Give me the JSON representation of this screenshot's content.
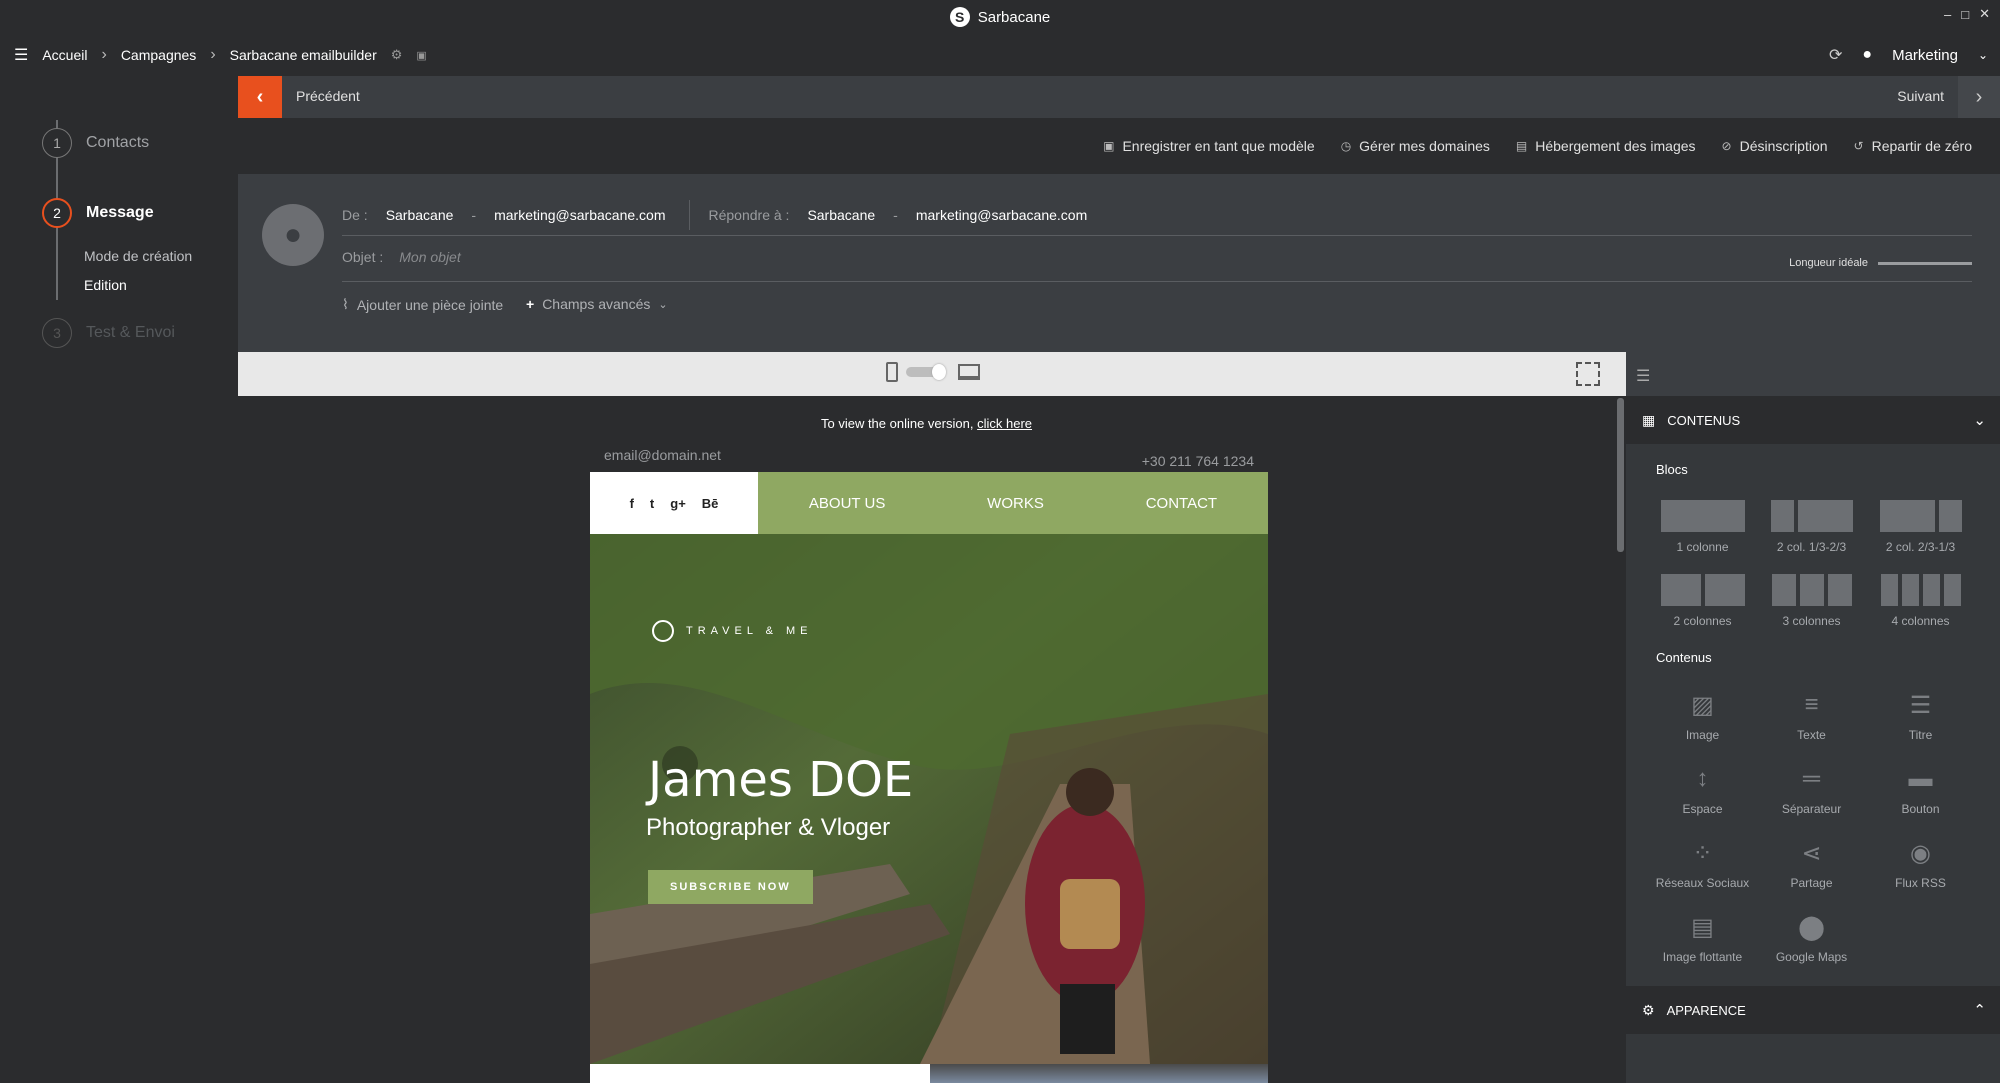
{
  "app": {
    "title": "Sarbacane",
    "logo_letter": "S"
  },
  "window_controls": [
    "–",
    "□",
    "✕"
  ],
  "breadcrumb": [
    {
      "label": "Accueil"
    },
    {
      "label": "Campagnes"
    },
    {
      "label": "Sarbacane emailbuilder"
    }
  ],
  "user": {
    "name": "Marketing"
  },
  "steps": [
    {
      "num": "1",
      "label": "Contacts"
    },
    {
      "num": "2",
      "label": "Message",
      "substeps": [
        "Mode de création",
        "Edition"
      ]
    },
    {
      "num": "3",
      "label": "Test & Envoi"
    }
  ],
  "nav": {
    "prev_label": "Précédent",
    "next_label": "Suivant"
  },
  "actions": [
    {
      "icon": "save-icon",
      "label": "Enregistrer en tant que modèle"
    },
    {
      "icon": "domain-icon",
      "label": "Gérer mes domaines"
    },
    {
      "icon": "image-hosting-icon",
      "label": "Hébergement des images"
    },
    {
      "icon": "unsubscribe-icon",
      "label": "Désinscription"
    },
    {
      "icon": "reset-icon",
      "label": "Repartir de zéro"
    }
  ],
  "form": {
    "from_label": "De :",
    "from_name": "Sarbacane",
    "from_email": "marketing@sarbacane.com",
    "reply_label": "Répondre à :",
    "reply_name": "Sarbacane",
    "reply_email": "marketing@sarbacane.com",
    "subject_label": "Objet :",
    "subject_placeholder": "Mon objet",
    "ideal_length": "Longueur idéale",
    "attachment_label": "Ajouter une pièce jointe",
    "advanced_label": "Champs avancés"
  },
  "email": {
    "online_version_text": "To view the online version,",
    "online_version_link": "click here",
    "email_address": "email@domain.net",
    "phone": "+30 211 764 1234",
    "social": [
      "f",
      "t",
      "g+",
      "Bē"
    ],
    "menu": [
      "ABOUT US",
      "WORKS",
      "CONTACT"
    ],
    "brand": "TRAVEL & ME",
    "hero_title": "James DOE",
    "hero_subtitle": "Photographer & Vloger",
    "cta": "SUBSCRIBE NOW"
  },
  "panel": {
    "contents_title": "CONTENUS",
    "blocks_title": "Blocs",
    "blocks": [
      {
        "label": "1 colonne",
        "parts": [
          1
        ]
      },
      {
        "label": "2 col. 1/3-2/3",
        "parts": [
          1,
          2
        ]
      },
      {
        "label": "2 col. 2/3-1/3",
        "parts": [
          2,
          1
        ]
      },
      {
        "label": "2 colonnes",
        "parts": [
          1,
          1
        ]
      },
      {
        "label": "3 colonnes",
        "parts": [
          1,
          1,
          1
        ]
      },
      {
        "label": "4 colonnes",
        "parts": [
          1,
          1,
          1,
          1
        ]
      }
    ],
    "contents_subtitle": "Contenus",
    "contents": [
      {
        "label": "Image",
        "icon": "image-icon"
      },
      {
        "label": "Texte",
        "icon": "text-icon"
      },
      {
        "label": "Titre",
        "icon": "title-icon"
      },
      {
        "label": "Espace",
        "icon": "space-icon"
      },
      {
        "label": "Séparateur",
        "icon": "separator-icon"
      },
      {
        "label": "Bouton",
        "icon": "button-icon"
      },
      {
        "label": "Réseaux Sociaux",
        "icon": "social-networks-icon"
      },
      {
        "label": "Partage",
        "icon": "share-icon"
      },
      {
        "label": "Flux RSS",
        "icon": "rss-icon"
      },
      {
        "label": "Image flottante",
        "icon": "floating-image-icon"
      },
      {
        "label": "Google Maps",
        "icon": "map-pin-icon"
      }
    ],
    "appearance_title": "APPARENCE"
  },
  "colors": {
    "accent": "#e8501e",
    "email_green": "#8fa862"
  }
}
